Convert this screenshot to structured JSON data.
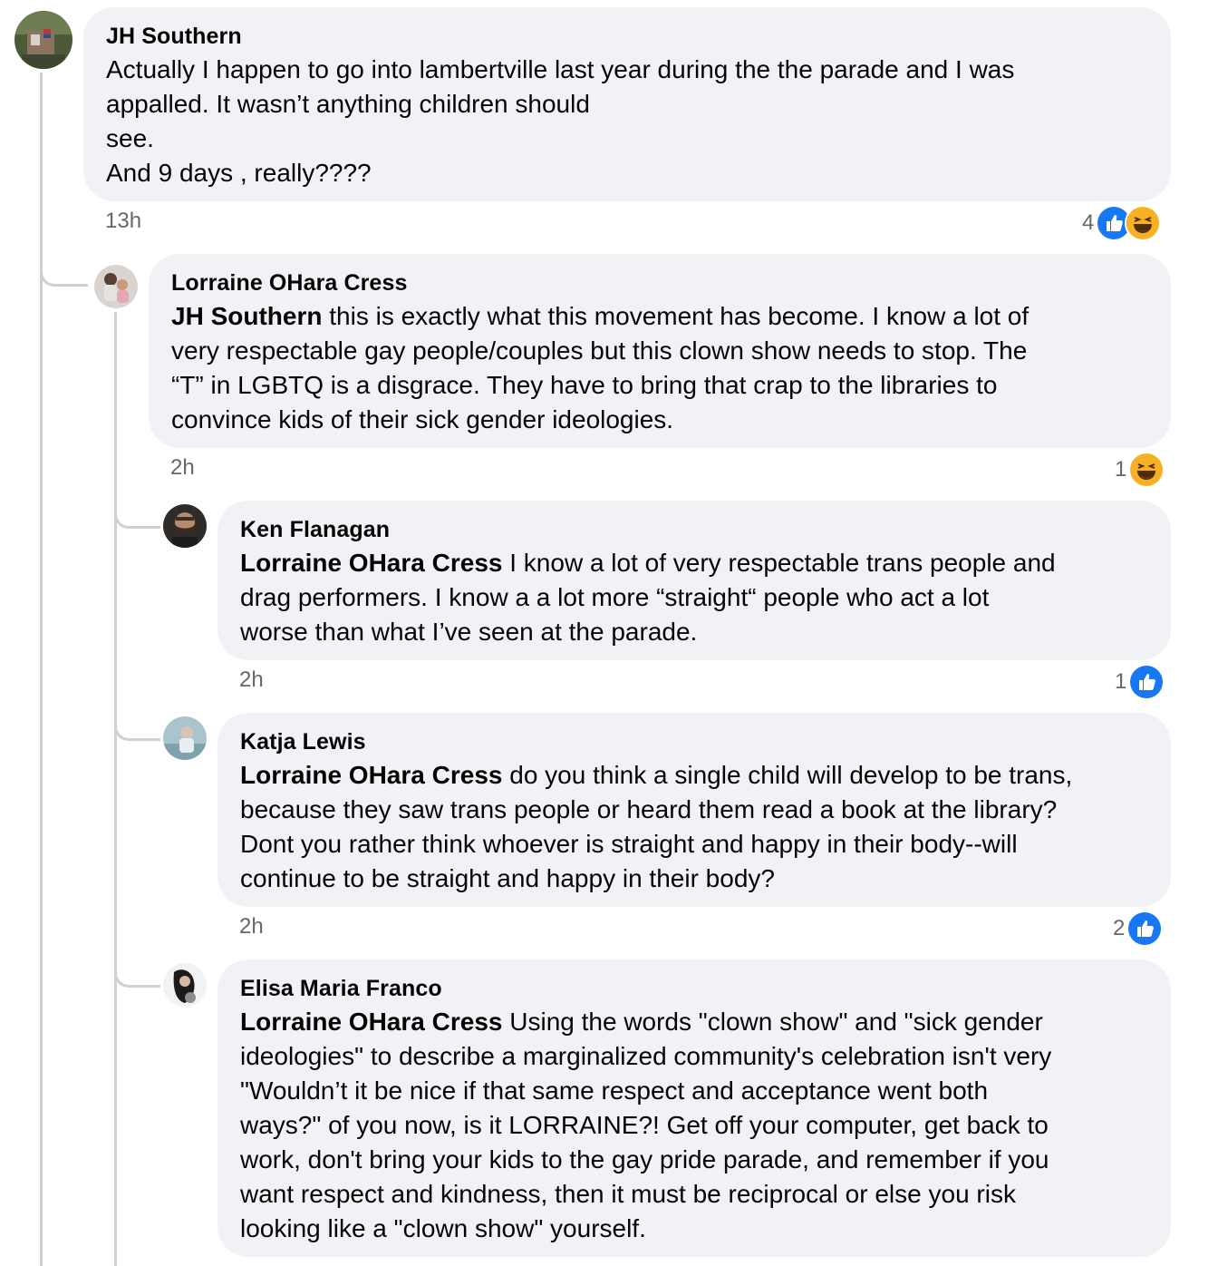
{
  "comments": [
    {
      "author": "JH Southern",
      "mention": "",
      "text": "Actually I happen to go into lambertville last year during the the parade and I was\nappalled. It wasn’t anything children should\nsee.\nAnd 9 days , really????",
      "time": "13h",
      "reaction_count": "4",
      "reactions": [
        "like-icon",
        "haha-icon"
      ]
    },
    {
      "author": "Lorraine OHara Cress",
      "mention": "JH Southern",
      "text": " this is exactly what this movement has become. I know a lot of\nvery respectable gay people/couples but this clown show needs to stop. The\n“T” in LGBTQ is a disgrace. They have to bring that crap to the libraries to\nconvince kids of their sick gender ideologies.",
      "time": "2h",
      "reaction_count": "1",
      "reactions": [
        "haha-icon"
      ]
    },
    {
      "author": "Ken Flanagan",
      "mention": "Lorraine OHara Cress",
      "text": " I know a lot of very respectable trans people and\ndrag performers. I know a a lot more “straight“ people who act a lot\nworse than what I’ve seen at the parade.",
      "time": "2h",
      "reaction_count": "1",
      "reactions": [
        "like-icon"
      ]
    },
    {
      "author": "Katja Lewis",
      "mention": "Lorraine OHara Cress",
      "text": " do you think a single child will develop to be trans,\nbecause they saw trans people or heard them read a book at the library?\nDont you rather think whoever is straight and happy in their body--will\ncontinue to be straight and happy in their body?",
      "time": "2h",
      "reaction_count": "2",
      "reactions": [
        "like-icon"
      ]
    },
    {
      "author": "Elisa Maria Franco",
      "mention": "Lorraine OHara Cress",
      "text": " Using the words \"clown show\" and \"sick gender\nideologies\" to describe a marginalized community's celebration isn't very\n\"Wouldn’t it be nice if that same respect and acceptance went both\nways?\" of you now, is it LORRAINE?! Get off your computer, get back to\nwork, don't bring your kids to the gay pride parade, and remember if you\nwant respect and kindness, then it must be reciprocal or else you risk\nlooking like a \"clown show\" yourself.",
      "time": "",
      "reaction_count": "",
      "reactions": []
    }
  ],
  "colors": {
    "bubble": "#f0f2f5",
    "thread_line": "#ced0d4",
    "meta_text": "#65676b",
    "like_blue": "#1877f2",
    "haha_yellow": "#f7b125"
  }
}
